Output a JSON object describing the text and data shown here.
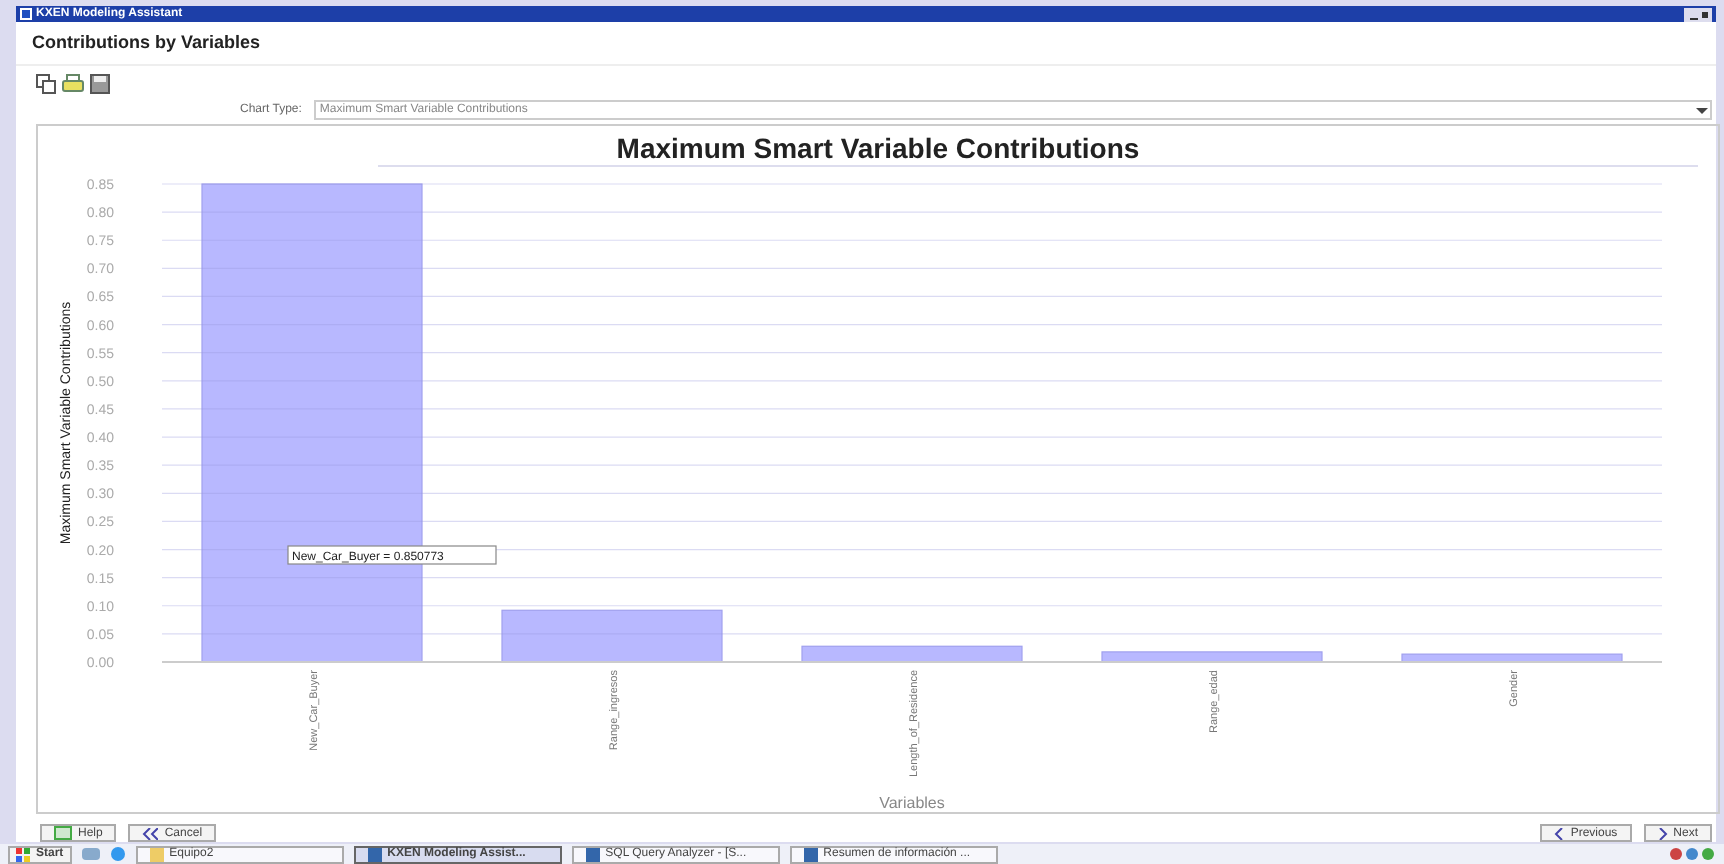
{
  "window": {
    "title": "KXEN Modeling Assistant"
  },
  "header": "Contributions by Variables",
  "chart_type": {
    "label": "Chart Type:",
    "value": "Maximum Smart Variable Contributions"
  },
  "chart": {
    "tooltip": "New_Car_Buyer = 0.850773",
    "chart_data": {
      "type": "bar",
      "title": "Maximum Smart Variable Contributions",
      "xlabel": "Variables",
      "ylabel": "Maximum Smart Variable Contributions",
      "categories": [
        "New_Car_Buyer",
        "Range_ingresos",
        "Length_of_Residence",
        "Range_edad",
        "Gender"
      ],
      "grid": true,
      "series": [
        {
          "color": "#b8b8ff",
          "values": [
            0.85,
            0.092,
            0.028,
            0.018,
            0.014
          ]
        }
      ],
      "ylim": [
        0,
        0.85
      ],
      "yticks": [
        {
          "value": 0,
          "label": "0.00"
        },
        {
          "value": 0.05,
          "label": "0.05"
        },
        {
          "value": 0.1,
          "label": "0.10"
        },
        {
          "value": 0.15,
          "label": "0.15"
        },
        {
          "value": 0.2,
          "label": "0.20"
        },
        {
          "value": 0.25,
          "label": "0.25"
        },
        {
          "value": 0.3,
          "label": "0.30"
        },
        {
          "value": 0.35,
          "label": "0.35"
        },
        {
          "value": 0.4,
          "label": "0.40"
        },
        {
          "value": 0.45,
          "label": "0.45"
        },
        {
          "value": 0.5,
          "label": "0.50"
        },
        {
          "value": 0.55,
          "label": "0.55"
        },
        {
          "value": 0.6,
          "label": "0.60"
        },
        {
          "value": 0.65,
          "label": "0.65"
        },
        {
          "value": 0.7,
          "label": "0.70"
        },
        {
          "value": 0.75,
          "label": "0.75"
        },
        {
          "value": 0.8,
          "label": "0.80"
        },
        {
          "value": 0.85,
          "label": "0.85"
        }
      ]
    }
  },
  "buttons_left": [
    "Help",
    "Cancel"
  ],
  "buttons_right": [
    "Previous",
    "Next"
  ],
  "taskbar": {
    "start": "Start",
    "items": [
      {
        "label": "Equipo2",
        "selected": false
      },
      {
        "label": "KXEN Modeling Assist...",
        "selected": true
      },
      {
        "label": "SQL Query Analyzer - [S...",
        "selected": false
      },
      {
        "label": "Resumen de información ...",
        "selected": false
      }
    ]
  }
}
